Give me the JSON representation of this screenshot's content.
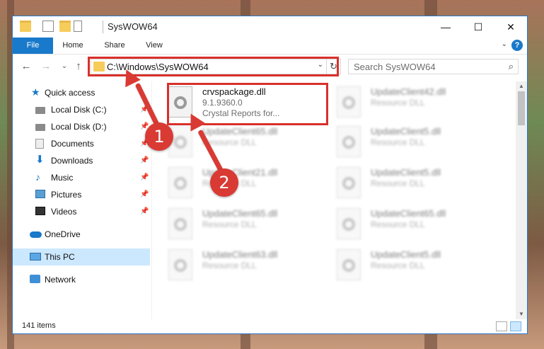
{
  "window": {
    "title": "SysWOW64",
    "minimize_glyph": "—",
    "maximize_glyph": "☐",
    "close_glyph": "✕"
  },
  "ribbon": {
    "tabs": [
      "File",
      "Home",
      "Share",
      "View"
    ],
    "help_glyph": "?",
    "collapse_glyph": "⌄"
  },
  "nav": {
    "back_glyph": "←",
    "forward_glyph": "→",
    "recent_glyph": "⌄",
    "up_glyph": "↑",
    "address": "C:\\Windows\\SysWOW64",
    "address_dropdown_glyph": "⌄",
    "refresh_glyph": "↻",
    "search_placeholder": "Search SysWOW64",
    "search_glyph": "⌕"
  },
  "sidebar": {
    "items": [
      {
        "label": "Quick access",
        "icon": "star-icon",
        "glyph": "★",
        "pinned": false
      },
      {
        "label": "Local Disk (C:)",
        "icon": "disk-icon",
        "pinned": true
      },
      {
        "label": "Local Disk (D:)",
        "icon": "disk-icon",
        "pinned": true
      },
      {
        "label": "Documents",
        "icon": "documents-icon",
        "pinned": true
      },
      {
        "label": "Downloads",
        "icon": "download-icon",
        "glyph": "⬇",
        "pinned": true
      },
      {
        "label": "Music",
        "icon": "music-icon",
        "glyph": "♪",
        "pinned": true
      },
      {
        "label": "Pictures",
        "icon": "pictures-icon",
        "pinned": true
      },
      {
        "label": "Videos",
        "icon": "videos-icon",
        "pinned": true
      },
      {
        "label": "OneDrive",
        "icon": "cloud-icon",
        "pinned": false
      },
      {
        "label": "This PC",
        "icon": "computer-icon",
        "pinned": false,
        "selected": true
      },
      {
        "label": "Network",
        "icon": "network-icon",
        "pinned": false
      }
    ],
    "pin_glyph": "📌"
  },
  "files": {
    "left": [
      {
        "name": "crvspackage.dll",
        "line1": "9.1.9360.0",
        "line2": "Crystal Reports for...",
        "highlighted": true
      },
      {
        "name": "UpdateClient65.dll",
        "line1": "Resource DLL"
      },
      {
        "name": "UpdateClient21.dll",
        "line1": "Resource DLL"
      },
      {
        "name": "UpdateClient65.dll",
        "line1": "Resource DLL"
      },
      {
        "name": "UpdateClient63.dll",
        "line1": "Resource DLL"
      }
    ],
    "right": [
      {
        "name": "UpdateClient42.dll",
        "line1": "Resource DLL"
      },
      {
        "name": "UpdateClient5.dll",
        "line1": "Resource DLL"
      },
      {
        "name": "UpdateClient5.dll",
        "line1": "Resource DLL"
      },
      {
        "name": "UpdateClient65.dll",
        "line1": "Resource DLL"
      },
      {
        "name": "UpdateClient5.dll",
        "line1": "Resource DLL"
      }
    ]
  },
  "scrollbar": {
    "up_glyph": "▲",
    "down_glyph": "▼"
  },
  "status": {
    "item_count": "141 items"
  },
  "annotations": {
    "badge1": "1",
    "badge2": "2",
    "color": "#d93a34"
  }
}
